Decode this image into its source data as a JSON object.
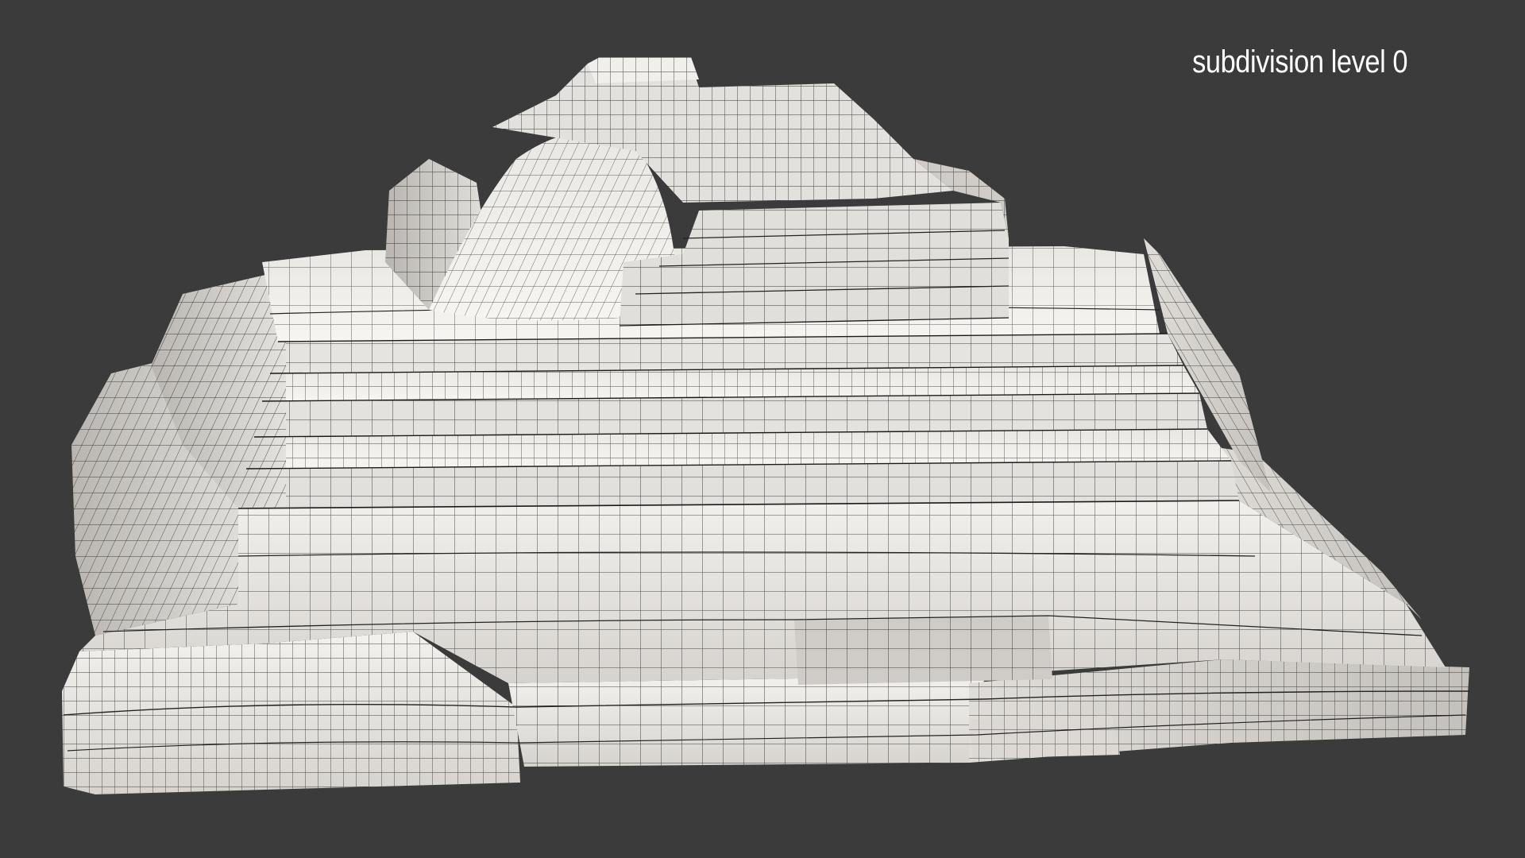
{
  "caption": "subdivision level 0",
  "subject": {
    "kind": "wireframe-render-stepped-pyramid",
    "colors": {
      "background": "#3b3b3b",
      "surface_light": "#f2f0ed",
      "surface_mid": "#d9d7d3",
      "surface_shadow": "#bdbab5",
      "wire": "#1e1e1e"
    }
  }
}
